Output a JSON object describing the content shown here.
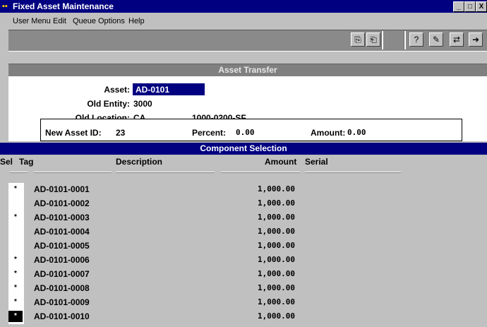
{
  "window": {
    "title": "Fixed Asset Maintenance",
    "controls": {
      "minimize": "_",
      "maximize": "□",
      "close": "X"
    }
  },
  "menu": {
    "items": [
      {
        "label": "User Menu"
      },
      {
        "label": "Edit"
      },
      {
        "label": "Queue"
      },
      {
        "label": "Options"
      },
      {
        "label": "Help"
      }
    ]
  },
  "toolbar": {
    "buttons": [
      "copy-icon",
      "paste-icon",
      "find-icon",
      "notes-icon",
      "transfer-icon",
      "exit-icon"
    ]
  },
  "section": {
    "title": "Asset Transfer"
  },
  "form": {
    "asset_label": "Asset:",
    "asset_value": "AD-0101",
    "old_entity_label": "Old Entity:",
    "old_entity_value": "3000",
    "old_location_label": "Old Location:",
    "old_location_value": "CA",
    "old_location_code": "1000-0200-SF"
  },
  "new_asset": {
    "id_label": "New Asset ID:",
    "id_value": "23",
    "percent_label": "Percent:",
    "percent_value": "0.00",
    "amount_label": "Amount:",
    "amount_value": "0.00"
  },
  "components": {
    "title": "Component Selection",
    "headers": {
      "sel": "Sel",
      "tag": "Tag",
      "description": "Description",
      "amount": "Amount",
      "serial": "Serial"
    },
    "rows": [
      {
        "sel": "*",
        "tag": "AD-0101-0001",
        "amount": "1,000.00"
      },
      {
        "sel": "",
        "tag": "AD-0101-0002",
        "amount": "1,000.00"
      },
      {
        "sel": "*",
        "tag": "AD-0101-0003",
        "amount": "1,000.00"
      },
      {
        "sel": "",
        "tag": "AD-0101-0004",
        "amount": "1,000.00"
      },
      {
        "sel": "",
        "tag": "AD-0101-0005",
        "amount": "1,000.00"
      },
      {
        "sel": "*",
        "tag": "AD-0101-0006",
        "amount": "1,000.00"
      },
      {
        "sel": "*",
        "tag": "AD-0101-0007",
        "amount": "1,000.00"
      },
      {
        "sel": "*",
        "tag": "AD-0101-0008",
        "amount": "1,000.00"
      },
      {
        "sel": "*",
        "tag": "AD-0101-0009",
        "amount": "1,000.00"
      },
      {
        "sel": "*",
        "tag": "AD-0101-0010",
        "amount": "1,000.00"
      }
    ]
  }
}
